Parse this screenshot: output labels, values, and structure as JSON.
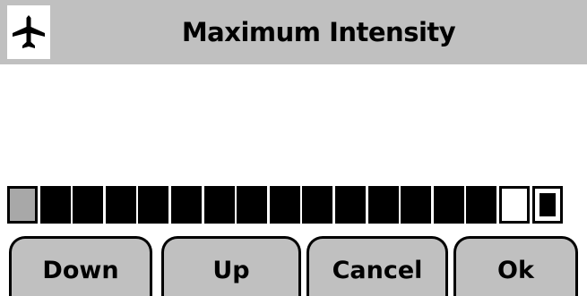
{
  "title": {
    "text": "Maximum Intensity",
    "icon": "airplane-icon"
  },
  "intensity": {
    "level": 15,
    "segments": [
      "current",
      "filled",
      "filled",
      "filled",
      "filled",
      "filled",
      "filled",
      "filled",
      "filled",
      "filled",
      "filled",
      "filled",
      "filled",
      "filled",
      "filled",
      "empty",
      "end"
    ]
  },
  "softkeys": [
    {
      "label": "Down"
    },
    {
      "label": "Up"
    },
    {
      "label": "Cancel"
    },
    {
      "label": "Ok"
    }
  ],
  "colors": {
    "titlebar": "#c0c0c0",
    "softkey": "#c0c0c0",
    "current_segment": "#a8a8a8"
  }
}
